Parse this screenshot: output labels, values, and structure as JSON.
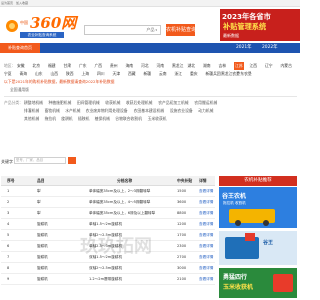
{
  "topbar": {
    "link1": "设为首页",
    "link2": "加入收藏"
  },
  "header": {
    "logo_prefix": "中国",
    "logo_title": "360网",
    "logo_sub": "农业补贴查询系统",
    "search_select": "产品",
    "search_button": "农机补贴查询"
  },
  "ad_header": {
    "line1": "2023年各省市",
    "line2": "补贴管理系统",
    "line3": "最新数据"
  },
  "nav": {
    "home": "补贴查询首页",
    "year1": "2021年",
    "year2": "2022年"
  },
  "filters": {
    "region_label": "地区：",
    "regions": [
      "安徽",
      "北京",
      "福建",
      "甘肃",
      "广东",
      "广西",
      "贵州",
      "海南",
      "河北",
      "河南",
      "黑龙江",
      "湖北",
      "湖南",
      "吉林",
      "江苏",
      "江西",
      "辽宁",
      "内蒙古",
      "宁夏",
      "青海",
      "山东",
      "山西",
      "陕西",
      "上海",
      "四川",
      "天津",
      "西藏",
      "新疆",
      "云南",
      "浙江",
      "重庆",
      "新疆兵团",
      "黑龙江农垦",
      "广东农垦"
    ],
    "notice_line1": "以下是2021年的购机补贴数据，最新数据请查询2022年补贴数据",
    "notice_line2": "全国通用版",
    "category_label": "产品分类：",
    "categories_row1": [
      "耕整地机械",
      "种植施肥机械",
      "田间管理机械",
      "收获机械",
      "收获后处理机械",
      "农产品初加工机械",
      "农用搬运机械"
    ],
    "categories_row2": [
      "排灌机械",
      "畜牧机械",
      "水产机械",
      "农业废弃物利用处理设备",
      "农田基本建设机械",
      "设施农业设备",
      "动力机械"
    ],
    "categories_row3": [
      "其他机械",
      "拖拉机",
      "旋耕机",
      "插秧机",
      "植保机械",
      "谷物联合收割机",
      "玉米收获机"
    ]
  },
  "table_search": {
    "label": "关键字",
    "placeholder": "型号、厂家、品目"
  },
  "table": {
    "headers": [
      "序号",
      "品目",
      "分档名称",
      "中央补贴",
      "详情"
    ],
    "rows": [
      {
        "no": "1",
        "name": "犁",
        "spec": "单体幅宽35cm及以上，2～3铧翻转犁",
        "price": "1500",
        "detail": "查看详情"
      },
      {
        "no": "2",
        "name": "犁",
        "spec": "单体幅宽35cm及以上，4～5铧翻转犁",
        "price": "3600",
        "detail": "查看详情"
      },
      {
        "no": "3",
        "name": "犁",
        "spec": "单体幅宽35cm及以上，6铧及以上翻转犁",
        "price": "8800",
        "detail": "查看详情"
      },
      {
        "no": "4",
        "name": "旋耕机",
        "spec": "单轴1.5～2m旋耕机",
        "price": "1200",
        "detail": "查看详情"
      },
      {
        "no": "5",
        "name": "旋耕机",
        "spec": "单轴2～2.5m旋耕机",
        "price": "1700",
        "detail": "查看详情"
      },
      {
        "no": "6",
        "name": "旋耕机",
        "spec": "单轴2.5～3m旋耕机",
        "price": "2300",
        "detail": "查看详情"
      },
      {
        "no": "7",
        "name": "旋耕机",
        "spec": "双轴1.5～2m旋耕机",
        "price": "2700",
        "detail": "查看详情"
      },
      {
        "no": "8",
        "name": "旋耕机",
        "spec": "双轴2～2.5m旋耕机",
        "price": "3000",
        "detail": "查看详情"
      },
      {
        "no": "9",
        "name": "旋耕机",
        "spec": "1.2～2m履带旋耕机",
        "price": "2100",
        "detail": "查看详情"
      }
    ]
  },
  "sidebar": {
    "title": "农机补贴推荐",
    "ad1_head": "谷王农机",
    "ad1_sub": "拖拉机 收割机",
    "ad2_head": "谷王",
    "ad3_h1": "勇猛四行",
    "ad3_h2": "玉米收获机"
  },
  "watermark": "玖玖拓网"
}
